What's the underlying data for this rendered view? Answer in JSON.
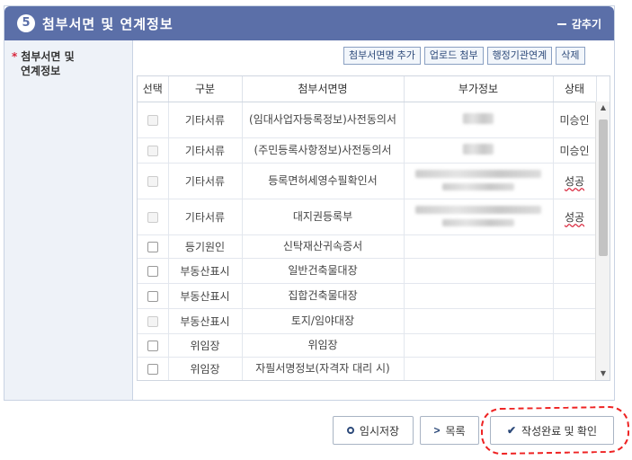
{
  "header": {
    "step_number": "5",
    "title": "첨부서면 및 연계정보",
    "collapse_label": "감추기"
  },
  "left": {
    "required_mark": "*",
    "label_line1": "첨부서면 및",
    "label_line2": "연계정보"
  },
  "toolbar": {
    "add_doc": "첨부서면명 추가",
    "upload": "업로드 첨부",
    "agency_link": "행정기관연계",
    "delete": "삭제"
  },
  "table": {
    "columns": [
      "선택",
      "구분",
      "첨부서면명",
      "부가정보",
      "상태"
    ],
    "rows": [
      {
        "type": "기타서류",
        "name": "(임대사업자등록정보)사전동의서",
        "status": "미승인",
        "checkbox_disabled": true,
        "blurred": "short"
      },
      {
        "type": "기타서류",
        "name": "(주민등록사항정보)사전동의서",
        "status": "미승인",
        "checkbox_disabled": true,
        "blurred": "short"
      },
      {
        "type": "기타서류",
        "name": "등록면허세영수필확인서",
        "status": "성공",
        "checkbox_disabled": true,
        "blurred": "long"
      },
      {
        "type": "기타서류",
        "name": "대지권등록부",
        "status": "성공",
        "checkbox_disabled": true,
        "blurred": "long"
      },
      {
        "type": "등기원인",
        "name": "신탁재산귀속증서",
        "status": "",
        "checkbox_disabled": false,
        "blurred": ""
      },
      {
        "type": "부동산표시",
        "name": "일반건축물대장",
        "status": "",
        "checkbox_disabled": false,
        "blurred": ""
      },
      {
        "type": "부동산표시",
        "name": "집합건축물대장",
        "status": "",
        "checkbox_disabled": false,
        "blurred": ""
      },
      {
        "type": "부동산표시",
        "name": "토지/임야대장",
        "status": "",
        "checkbox_disabled": true,
        "blurred": ""
      },
      {
        "type": "위임장",
        "name": "위임장",
        "status": "",
        "checkbox_disabled": false,
        "blurred": ""
      },
      {
        "type": "위임장",
        "name": "자필서명정보(자격자 대리 시)",
        "status": "",
        "checkbox_disabled": false,
        "blurred": ""
      }
    ]
  },
  "buttons": {
    "temp_save": "임시저장",
    "list": "목록",
    "complete": "작성완료 및 확인"
  },
  "colors": {
    "header_bg": "#5b6fa8",
    "required": "#d9263c",
    "button_text": "#2d4a7a"
  }
}
